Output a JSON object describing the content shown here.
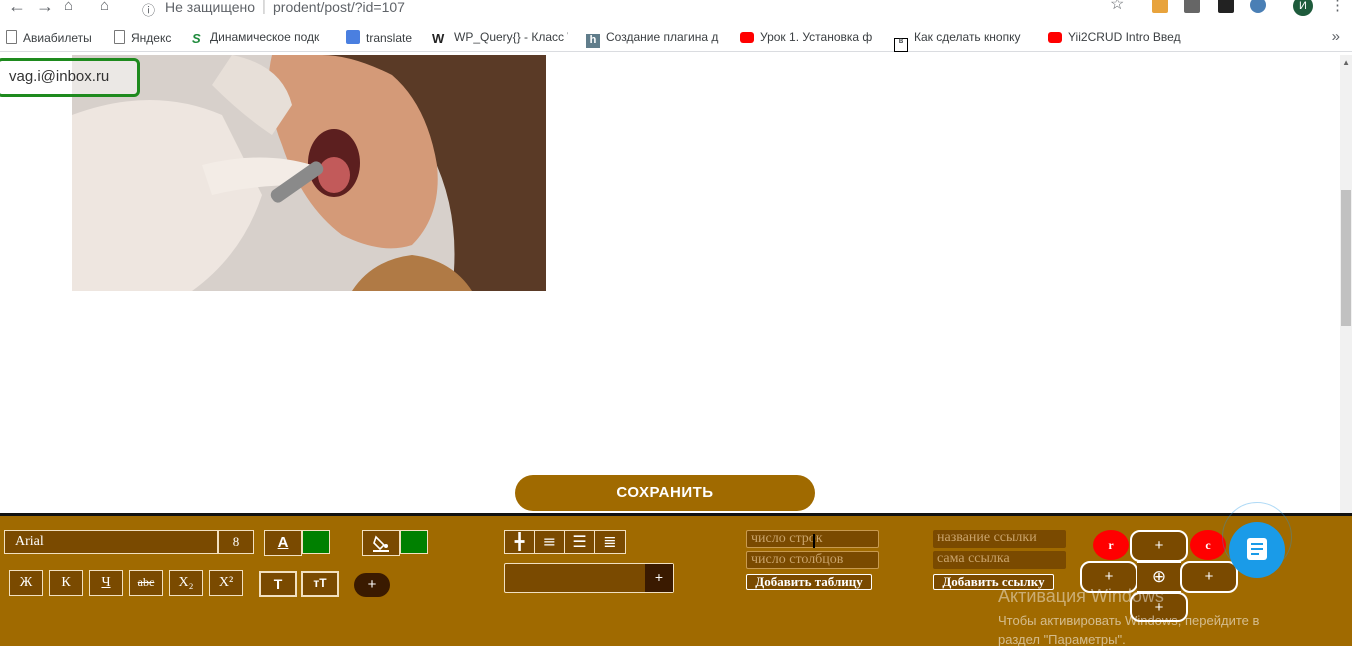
{
  "browser": {
    "security_label": "Не защищено",
    "url": "prodent/post/?id=107",
    "profile_initial": "И",
    "bookmarks": [
      "Авиабилеты",
      "Яндекс",
      "Динамическое подк",
      "translate",
      "WP_Query{} - Класс \\",
      "Создание плагина д",
      "Урок 1. Установка ф",
      "Как сделать кнопку",
      "Yii2CRUD Intro Введ"
    ],
    "more_label": "»"
  },
  "page": {
    "email": "vag.i@inbox.ru",
    "save_label": "СОХРАНИТЬ"
  },
  "toolbar": {
    "font_name": "Arial",
    "font_size": "8",
    "text_color_label": "A",
    "text_color": "#008000",
    "fill_color": "#008000",
    "format_buttons": [
      "Ж",
      "К",
      "Ч",
      "abc",
      "X₂",
      "X²"
    ],
    "t_buttons": [
      "T",
      "тT"
    ],
    "plus_label": "+",
    "table_rows_placeholder": "число строк",
    "table_cols_placeholder": "число столбцов",
    "add_table_label": "Добавить таблицу",
    "link_name_placeholder": "название ссылки",
    "link_url_placeholder": "сама ссылка",
    "add_link_label": "Добавить ссылку",
    "r_label": "r",
    "c_label": "c",
    "pad_plus": "+",
    "pad_center": "⊕"
  },
  "watermark": {
    "title": "Активация Windows",
    "line1": "Чтобы активировать Windows, перейдите в",
    "line2": "раздел \"Параметры\"."
  },
  "colors": {
    "panel": "#a06a00",
    "panel_dark": "#7a4a00",
    "accent_blue": "#1a9be8",
    "red": "#ff0000",
    "green": "#008000"
  }
}
